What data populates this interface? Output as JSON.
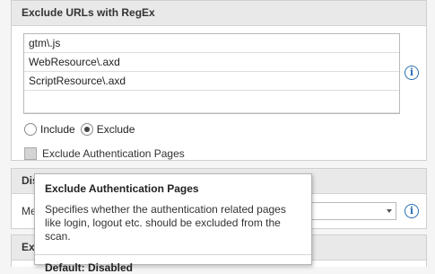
{
  "exclude_urls": {
    "title": "Exclude URLs with RegEx",
    "items": [
      "gtm\\.js",
      "WebResource\\.axd",
      "ScriptResource\\.axd",
      ""
    ],
    "radio_include": "Include",
    "radio_exclude": "Exclude",
    "selected": "Exclude",
    "checkbox_label": "Exclude Authentication Pages",
    "checkbox_checked": false
  },
  "panel2": {
    "title_partial": "Dis",
    "label_partial": "Me"
  },
  "panel3": {
    "title_partial": "Exc"
  },
  "tooltip": {
    "title": "Exclude Authentication Pages",
    "description": "Specifies whether the authentication related pages like login, logout etc. should be excluded from the scan.",
    "default": "Default: Disabled"
  },
  "icons": {
    "info": "info-icon",
    "dropdown": "chevron-down-icon"
  },
  "colors": {
    "info_blue": "#2a6fb3",
    "header_bg": "#e9e9e9"
  }
}
